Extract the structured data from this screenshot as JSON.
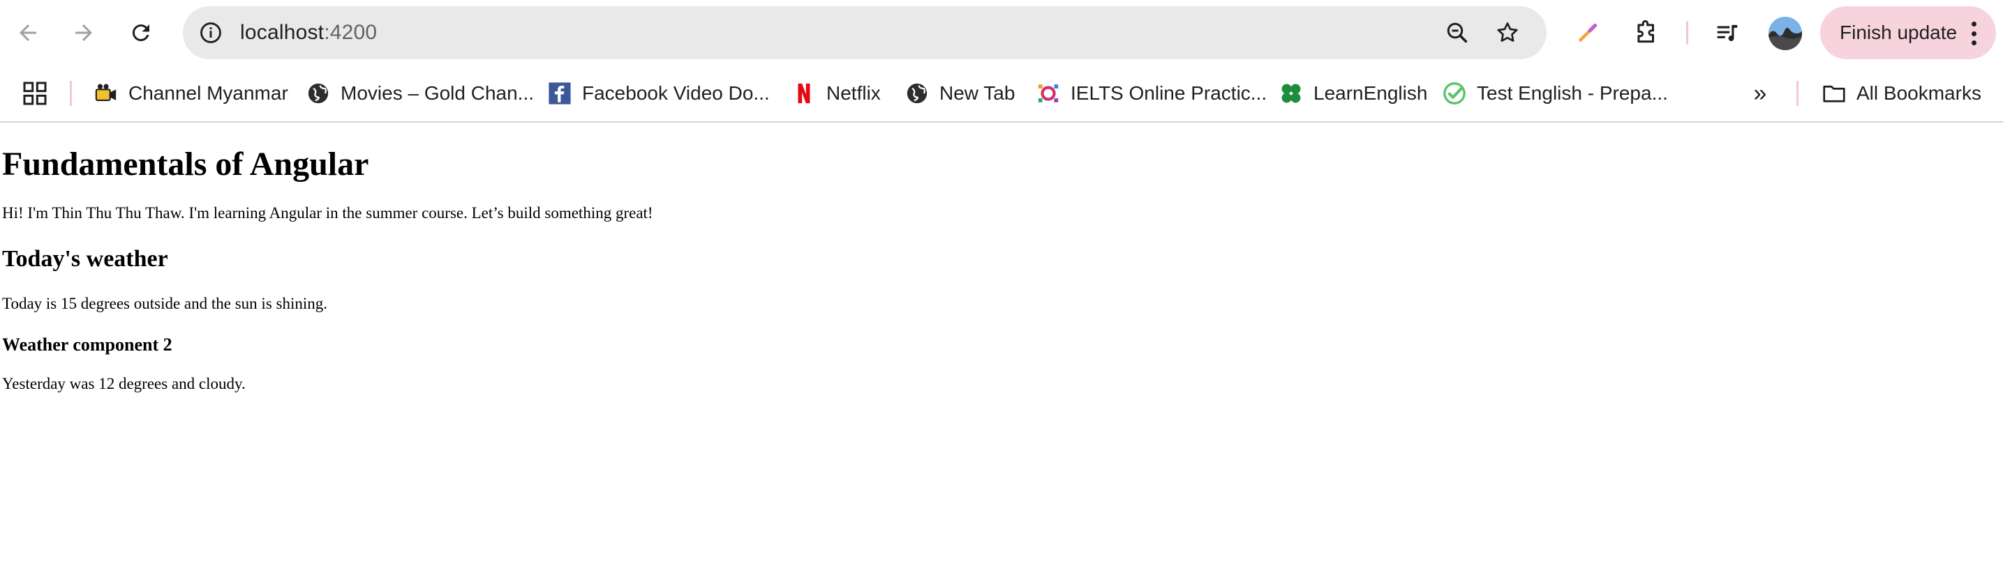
{
  "browser": {
    "address": {
      "host": "localhost",
      "port": ":4200"
    },
    "update_button_label": "Finish update",
    "bookmarks": [
      {
        "label": "Channel Myanmar",
        "icon": "camera-icon"
      },
      {
        "label": "Movies – Gold Chan...",
        "icon": "globe-icon"
      },
      {
        "label": "Facebook Video Do...",
        "icon": "facebook-icon"
      },
      {
        "label": "Netflix",
        "icon": "netflix-icon"
      },
      {
        "label": "New Tab",
        "icon": "globe-icon"
      },
      {
        "label": "IELTS Online Practic...",
        "icon": "ielts-icon"
      },
      {
        "label": "LearnEnglish",
        "icon": "learnenglish-icon"
      },
      {
        "label": "Test English - Prepa...",
        "icon": "check-icon"
      }
    ],
    "all_bookmarks_label": "All Bookmarks",
    "colors": {
      "omnibox": "#e9e9e9",
      "update_button": "#f6d3dd",
      "netflix": "#e50914",
      "facebook": "#3b5998"
    }
  },
  "page": {
    "title": "Fundamentals of Angular",
    "intro": "Hi! I'm Thin Thu Thu Thaw. I'm learning Angular in the summer course. Let’s build something great!",
    "weather_heading": "Today's weather",
    "weather_text": "Today is 15 degrees outside and the sun is shining.",
    "weather2_heading": "Weather component 2",
    "weather2_text": "Yesterday was 12 degrees and cloudy."
  }
}
